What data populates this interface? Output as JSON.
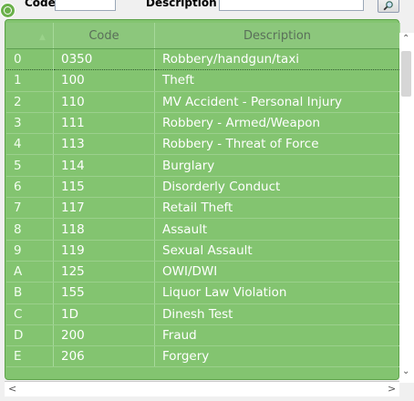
{
  "filters": {
    "code_label": "Code",
    "code_value": "",
    "description_label": "Description",
    "description_value": ""
  },
  "grid": {
    "columns": [
      "",
      "Code",
      "Description"
    ],
    "rows": [
      {
        "idx": "0",
        "code": "0350",
        "desc": "Robbery/handgun/taxi"
      },
      {
        "idx": "1",
        "code": "100",
        "desc": "Theft"
      },
      {
        "idx": "2",
        "code": "110",
        "desc": "MV Accident - Personal Injury"
      },
      {
        "idx": "3",
        "code": "111",
        "desc": "Robbery - Armed/Weapon"
      },
      {
        "idx": "4",
        "code": "113",
        "desc": "Robbery - Threat of Force"
      },
      {
        "idx": "5",
        "code": "114",
        "desc": "Burglary"
      },
      {
        "idx": "6",
        "code": "115",
        "desc": "Disorderly Conduct"
      },
      {
        "idx": "7",
        "code": "117",
        "desc": "Retail Theft"
      },
      {
        "idx": "8",
        "code": "118",
        "desc": "Assault"
      },
      {
        "idx": "9",
        "code": "119",
        "desc": "Sexual Assault"
      },
      {
        "idx": "A",
        "code": "125",
        "desc": "OWI/DWI"
      },
      {
        "idx": "B",
        "code": "155",
        "desc": "Liquor Law Violation"
      },
      {
        "idx": "C",
        "code": "1D",
        "desc": "Dinesh Test"
      },
      {
        "idx": "D",
        "code": "200",
        "desc": "Fraud"
      },
      {
        "idx": "E",
        "code": "206",
        "desc": "Forgery"
      }
    ]
  },
  "icons": {
    "search": "magnifier-icon",
    "target": "target-icon",
    "scroll_up": "up-arrow-icon",
    "scroll_down": "down-arrow-icon",
    "scroll_left": "left-arrow-icon",
    "scroll_right": "right-arrow-icon"
  },
  "colors": {
    "highlight": "#83c470",
    "highlight_border": "#5ea34a"
  }
}
